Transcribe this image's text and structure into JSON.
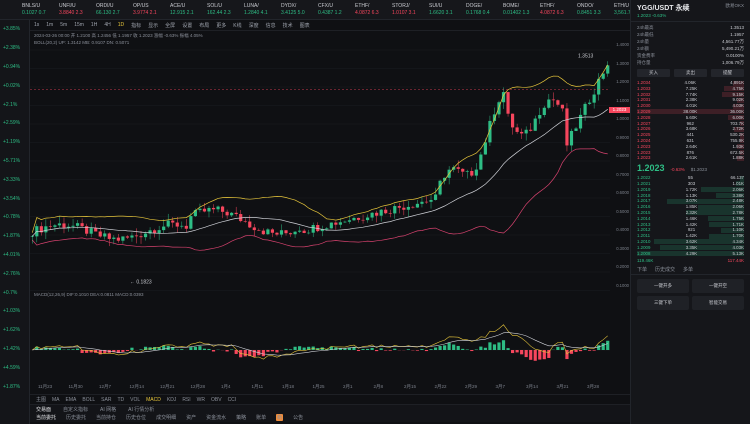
{
  "tickers": [
    {
      "name": "BNLS/U",
      "value": "0.1027 0.7",
      "dir": "up"
    },
    {
      "name": "UNFI/U",
      "value": "3.8840 2.3",
      "dir": "dn"
    },
    {
      "name": "ORDI/U",
      "value": "66.130 2.7",
      "dir": "up"
    },
    {
      "name": "OP/US",
      "value": "3.9774 2.1",
      "dir": "dn"
    },
    {
      "name": "ACE/U",
      "value": "12.915 2.1",
      "dir": "up"
    },
    {
      "name": "SOL/U",
      "value": "162.44 2.3",
      "dir": "up"
    },
    {
      "name": "LUNA/",
      "value": "1.2840 4.1",
      "dir": "up"
    },
    {
      "name": "DYDX/",
      "value": "3.4125 5.0",
      "dir": "up"
    },
    {
      "name": "CFX/U",
      "value": "0.4387 1.2",
      "dir": "up"
    },
    {
      "name": "ETHF/",
      "value": "4.0872 6.3",
      "dir": "dn"
    },
    {
      "name": "STORJ/",
      "value": "1.0107 3.1",
      "dir": "dn"
    },
    {
      "name": "SUI/U",
      "value": "1.6620 3.1",
      "dir": "up"
    },
    {
      "name": "DOGE/",
      "value": "0.1768 0.4",
      "dir": "up"
    },
    {
      "name": "BOME/",
      "value": "0.01402 1.3",
      "dir": "up"
    },
    {
      "name": "ETHF/",
      "value": "4.0872 6.3",
      "dir": "dn"
    },
    {
      "name": "ONDO/",
      "value": "0.8451 3.3",
      "dir": "up"
    },
    {
      "name": "ETH/U",
      "value": "3,561.7 3.6",
      "dir": "up"
    },
    {
      "name": "ALT/U",
      "value": "0.5021 2.4",
      "dir": "up"
    },
    {
      "name": "UNI/U",
      "value": "12.731 2.8",
      "dir": "dn"
    }
  ],
  "watchlist": [
    "+3.85%",
    "+2.38%",
    "+0.94%",
    "+0.02%",
    "+2.1%",
    "+2.59%",
    "+1.19%",
    "+5.71%",
    "+3.33%",
    "+3.54%",
    "+0.78%",
    "+1.87%",
    "+4.01%",
    "+2.76%",
    "+0.7%",
    "+1.03%",
    "+1.62%",
    "+1.42%",
    "+4.59%",
    "+1.87%"
  ],
  "toolbar": [
    "1s",
    "1m",
    "5m",
    "15m",
    "1H",
    "4H",
    "1D",
    "指标",
    "显示",
    "全屏",
    "设置",
    "布局",
    "更多",
    "K线",
    "深度",
    "信息",
    "技术",
    "图表"
  ],
  "toolbar_active": "1D",
  "chart_info_1": "2024-03-26 00:00  开 1.2100  高 1.2456  低 1.1957  收 1.2023  涨幅 -0.63%  振幅 4.05%",
  "chart_info_2": "BOLL(20,2)  UP: 1.3142  MB: 0.9107  DN: 0.5071",
  "yaxis_labels": [
    "1.4000",
    "1.3000",
    "1.2000",
    "1.1000",
    "1.0000",
    "0.9000",
    "0.8000",
    "0.7000",
    "0.6000",
    "0.5000",
    "0.4000",
    "0.3000",
    "0.2000",
    "0.1000"
  ],
  "current_price": "1.2023",
  "high_mark": "1.3513",
  "low_mark": "0.1823",
  "macd_label": "MACD(12,26,9)  DIF:0.1010  DEA:0.0811  MACD:0.0393",
  "xaxis_labels": [
    "11月23",
    "11月30",
    "12月7",
    "12月14",
    "12月21",
    "12月28",
    "1月4",
    "1月11",
    "1月18",
    "1月25",
    "2月1",
    "2月8",
    "2月15",
    "2月22",
    "2月29",
    "3月7",
    "3月14",
    "3月21",
    "3月28"
  ],
  "indicator_bar": [
    "主图",
    "MA",
    "EMA",
    "BOLL",
    "SAR",
    "TD",
    "VOL",
    "MACD",
    "KDJ",
    "RSI",
    "WR",
    "OBV",
    "CCI"
  ],
  "indicator_active": "MACD",
  "bottom_tabs": [
    "交易面",
    "自定义指标",
    "AI 网格",
    "AI 行情分析"
  ],
  "bottom_subtabs": [
    "当前委托",
    "历史委托",
    "当前持仓",
    "历史仓位",
    "成交明细",
    "资产",
    "资金流水",
    "策略",
    "账单",
    "新",
    "公告"
  ],
  "right": {
    "pair": "YGG/USDT 永续",
    "sub": "1.2023 -0.63%",
    "exchange": "欧易OKX",
    "stats": [
      [
        "24h最高",
        "1.3513"
      ],
      [
        "24h最低",
        "1.1957"
      ],
      [
        "24h量",
        "4,561.77万"
      ],
      [
        "24h额",
        "5,490.21万"
      ],
      [
        "资金费率",
        "0.0100%"
      ],
      [
        "持仓量",
        "1,006.79万"
      ]
    ],
    "buttons": [
      "买入",
      "卖出",
      "提醒"
    ],
    "asks": [
      [
        "1.2034",
        "4.06K",
        "4,891K"
      ],
      [
        "1.2033",
        "7.25K",
        "4.75K"
      ],
      [
        "1.2032",
        "7.74K",
        "9.15K"
      ],
      [
        "1.2031",
        "2.38K",
        "9.02K"
      ],
      [
        "1.2030",
        "4.01K",
        "4.03K"
      ],
      [
        "1.2029",
        "38.00K",
        "36.00K"
      ],
      [
        "1.2028",
        "5.60K",
        "6.00K"
      ],
      [
        "1.2027",
        "962",
        "703.7K"
      ],
      [
        "1.2026",
        "3.68K",
        "2.72K"
      ],
      [
        "1.2025",
        "441",
        "530.2K"
      ],
      [
        "1.2024",
        "631",
        "755.9K"
      ],
      [
        "1.2023",
        "2.64K",
        "1.93K"
      ],
      [
        "1.2023",
        "876",
        "672.5K"
      ],
      [
        "1.2023",
        "2.61K",
        "1.88K"
      ]
    ],
    "mid_price": "1.2023",
    "mid_change": "-0.63%",
    "mid_usd": "$1.2023",
    "bids": [
      [
        "1.2022",
        "55",
        "66.137"
      ],
      [
        "1.2021",
        "303",
        "1.01K"
      ],
      [
        "1.2019",
        "1.72K",
        "2.06K"
      ],
      [
        "1.2018",
        "1.13K",
        "3.38K"
      ],
      [
        "1.2017",
        "3.07K",
        "2.48K"
      ],
      [
        "1.2016",
        "1.85K",
        "2.06K"
      ],
      [
        "1.2015",
        "2.32K",
        "2.78K"
      ],
      [
        "1.2014",
        "1.46K",
        "1.75K"
      ],
      [
        "1.2013",
        "1.42K",
        "1.71K"
      ],
      [
        "1.2012",
        "921",
        "1.10K"
      ],
      [
        "1.2011",
        "1.42K",
        "1.70K"
      ],
      [
        "1.2010",
        "3.62K",
        "4.34K"
      ],
      [
        "1.2009",
        "3.35K",
        "4.03K"
      ],
      [
        "1.2008",
        "4.29K",
        "5.13K"
      ]
    ],
    "totals": [
      "119.46K",
      "117.44K"
    ],
    "rtabs": [
      "下单",
      "历史成交",
      "多单"
    ],
    "actions": [
      "一键开多",
      "一键开空",
      "三键下单",
      "智能交易"
    ]
  },
  "colors": {
    "up": "#2ebd85",
    "down": "#f6465d",
    "accent": "#e7c63b",
    "boll_up": "#e7c63b",
    "boll_mid": "#d0d2d8",
    "boll_dn": "#d6426e"
  }
}
